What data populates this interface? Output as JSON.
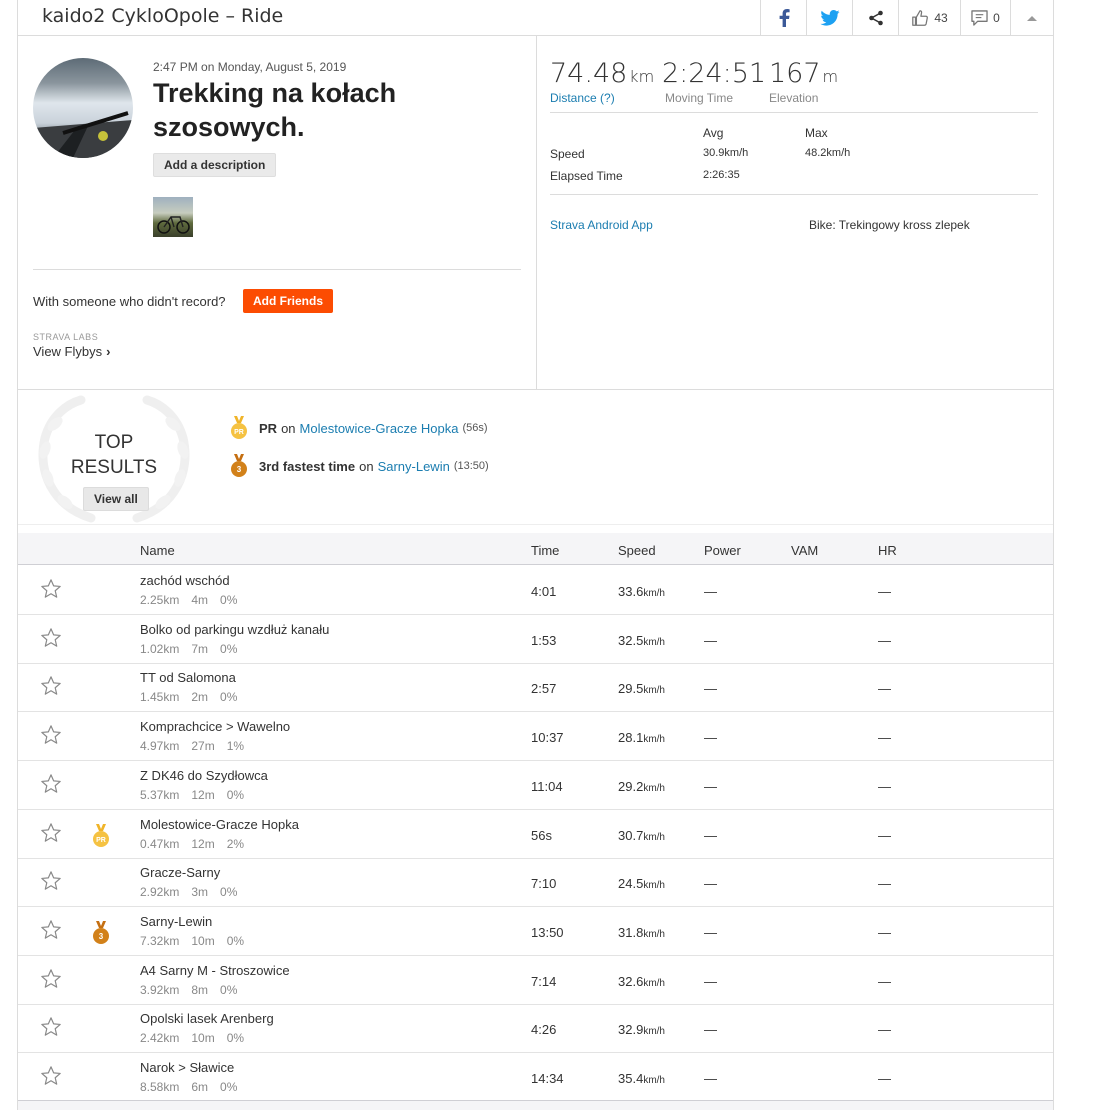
{
  "header": {
    "title": "kaido2 CykloOpole – Ride",
    "kudos_count": "43",
    "comments_count": "0"
  },
  "activity": {
    "datetime": "2:47 PM on Monday, August 5, 2019",
    "title": "Trekking na kołach szosowych.",
    "add_description": "Add a description",
    "with_someone": "With someone who didn't record?",
    "add_friends": "Add Friends",
    "labs_label": "STRAVA LABS",
    "view_flybys": "View Flybys",
    "flybys_chevron": "›"
  },
  "stats": {
    "distance": {
      "value": "74.48",
      "unit": "km",
      "label": "Distance (?)"
    },
    "moving_time": {
      "value": "2:24:51",
      "label": "Moving Time"
    },
    "elevation": {
      "value": "167",
      "unit": "m",
      "label": "Elevation"
    },
    "table": {
      "col_avg": "Avg",
      "col_max": "Max",
      "speed_label": "Speed",
      "speed_avg": "30.9km/h",
      "speed_max": "48.2km/h",
      "elapsed_label": "Elapsed Time",
      "elapsed_avg": "2:26:35"
    },
    "device": "Strava Android App",
    "bike": "Bike: Trekingowy kross zlepek"
  },
  "top_results": {
    "title_line1": "TOP",
    "title_line2": "RESULTS",
    "view_all": "View all",
    "items": [
      {
        "medal": "PR",
        "strong": "PR",
        "prefix": "on",
        "segment": "Molestowice-Gracze Hopka",
        "time": "(56s)"
      },
      {
        "medal": "3",
        "strong": "3rd fastest time",
        "prefix": "on",
        "segment": "Sarny-Lewin",
        "time": "(13:50)"
      }
    ]
  },
  "segments": {
    "columns": [
      "Name",
      "Time",
      "Speed",
      "Power",
      "VAM",
      "HR"
    ],
    "dash": "—",
    "rows": [
      {
        "name": "zachód wschód",
        "dist": "2.25km",
        "elev": "4m",
        "grade": "0%",
        "time": "4:01",
        "speed": "33.6",
        "unit": "km/h",
        "medal": ""
      },
      {
        "name": "Bolko od parkingu wzdłuż kanału",
        "dist": "1.02km",
        "elev": "7m",
        "grade": "0%",
        "time": "1:53",
        "speed": "32.5",
        "unit": "km/h",
        "medal": ""
      },
      {
        "name": "TT od Salomona",
        "dist": "1.45km",
        "elev": "2m",
        "grade": "0%",
        "time": "2:57",
        "speed": "29.5",
        "unit": "km/h",
        "medal": ""
      },
      {
        "name": "Komprachcice > Wawelno",
        "dist": "4.97km",
        "elev": "27m",
        "grade": "1%",
        "time": "10:37",
        "speed": "28.1",
        "unit": "km/h",
        "medal": ""
      },
      {
        "name": "Z DK46 do Szydłowca",
        "dist": "5.37km",
        "elev": "12m",
        "grade": "0%",
        "time": "11:04",
        "speed": "29.2",
        "unit": "km/h",
        "medal": ""
      },
      {
        "name": "Molestowice-Gracze Hopka",
        "dist": "0.47km",
        "elev": "12m",
        "grade": "2%",
        "time": "56s",
        "speed": "30.7",
        "unit": "km/h",
        "medal": "PR"
      },
      {
        "name": "Gracze-Sarny",
        "dist": "2.92km",
        "elev": "3m",
        "grade": "0%",
        "time": "7:10",
        "speed": "24.5",
        "unit": "km/h",
        "medal": ""
      },
      {
        "name": "Sarny-Lewin",
        "dist": "7.32km",
        "elev": "10m",
        "grade": "0%",
        "time": "13:50",
        "speed": "31.8",
        "unit": "km/h",
        "medal": "3"
      },
      {
        "name": "A4 Sarny M - Stroszowice",
        "dist": "3.92km",
        "elev": "8m",
        "grade": "0%",
        "time": "7:14",
        "speed": "32.6",
        "unit": "km/h",
        "medal": ""
      },
      {
        "name": "Opolski lasek Arenberg",
        "dist": "2.42km",
        "elev": "10m",
        "grade": "0%",
        "time": "4:26",
        "speed": "32.9",
        "unit": "km/h",
        "medal": ""
      },
      {
        "name": "Narok > Sławice",
        "dist": "8.58km",
        "elev": "6m",
        "grade": "0%",
        "time": "14:34",
        "speed": "35.4",
        "unit": "km/h",
        "medal": ""
      }
    ]
  },
  "colors": {
    "brand_orange": "#fc4c02",
    "link_blue": "#1b7db0",
    "gold_medal": "#f5c242",
    "bronze_medal": "#d2811a"
  }
}
